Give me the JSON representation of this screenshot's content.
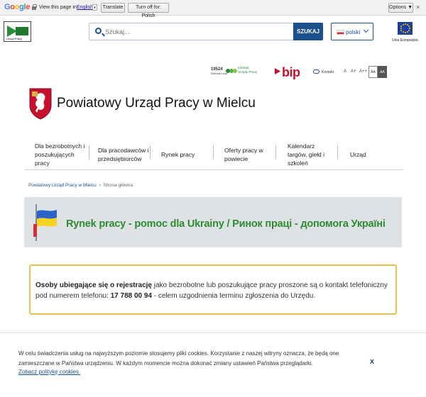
{
  "translate_bar": {
    "view_label": "View this page in:",
    "language": "English",
    "translate_label": "Translate",
    "turn_off_label": "Turn off for: Polish",
    "options_label": "Options ▼",
    "close": "×"
  },
  "header": {
    "logo_caption": "Urząd Pracy",
    "search_placeholder": "Szukaj...",
    "search_button": "SZUKAJ",
    "language_selected": "polski",
    "eu_label": "Unia Europejska"
  },
  "utility": {
    "infolinia_number": "19524",
    "infolinia_sub": "Zielona Linia",
    "infolinia_text_1": "Infolinia",
    "infolinia_text_2": "Urzędu Pracy",
    "bip": "bip",
    "contact": "Kontakt",
    "font_sizes": [
      "A",
      "A+",
      "A++"
    ],
    "contrast_1": "AA",
    "contrast_2": "AA"
  },
  "site_title": "Powiatowy Urząd Pracy w Mielcu",
  "nav": {
    "items": [
      "Dla bezrobotnych i poszukujących pracy",
      "Dla pracodawców i przedsiębiorców",
      "Rynek pracy",
      "Oferty pracy w powiecie",
      "Kalendarz targów, giełd i szkoleń",
      "Urząd"
    ]
  },
  "breadcrumb": {
    "home": "Powiatowy Urząd Pracy w Mielcu",
    "sep": ">",
    "current": "Strona główna"
  },
  "banner": {
    "text": "Rynek pracy - pomoc dla Ukrainy / Ринок праці - допомога Україні"
  },
  "notice": {
    "bold_text": "Osoby ubiegające się o rejestrację",
    "text_1": " jako bezrobotne lub poszukujące pracy proszone są o kontakt telefoniczny pod numerem telefonu: ",
    "phone": "17 788 00 94",
    "text_2": " - celem uzgodnienia terminu zgłoszenia do Urzędu."
  },
  "cookie": {
    "text": "W celu świadczenia usług na najwyższym poziomie stosujemy pliki cookies. Korzystanie z naszej witryny oznacza, że będą one zamieszczane w Państwa urządzeniu. W każdym momencie można dokonać zmiany ustawień Państwa przeglądarki.",
    "link": "Zobacz politykę cookies.",
    "close": "x"
  },
  "colors": {
    "brand_blue": "#1b4f8d",
    "banner_green": "#2f8a34",
    "notice_border": "#e8c047",
    "bip_red": "#c8102e"
  }
}
